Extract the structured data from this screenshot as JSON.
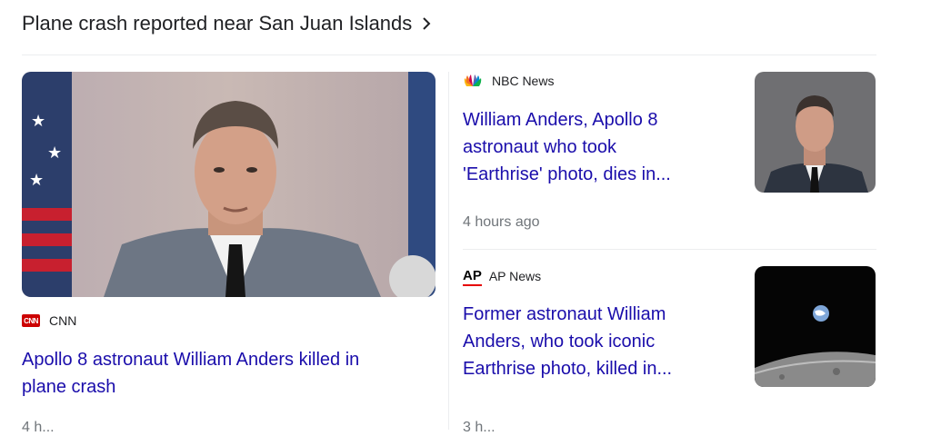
{
  "header": {
    "title": "Plane crash reported near San Juan Islands",
    "chevron": "chevron-right-icon"
  },
  "main_story": {
    "source": "CNN",
    "source_logo_text": "CNN",
    "headline_line1": "Apollo 8 astronaut William Anders killed in",
    "headline_line2": "plane crash",
    "time": "4 h..."
  },
  "stories": [
    {
      "source": "NBC News",
      "source_icon": "peacock-icon",
      "headline_line1": "William Anders, Apollo 8",
      "headline_line2": "astronaut who took",
      "headline_line3": "'Earthrise' photo, dies in...",
      "time": "4 hours ago"
    },
    {
      "source": "AP News",
      "source_logo_text": "AP",
      "headline_line1": "Former astronaut William",
      "headline_line2": "Anders, who took iconic",
      "headline_line3": "Earthrise photo, killed in...",
      "time": "3 h..."
    }
  ],
  "colors": {
    "link": "#1a0dab",
    "cnn_red": "#cc0000",
    "meta": "#70757a"
  }
}
